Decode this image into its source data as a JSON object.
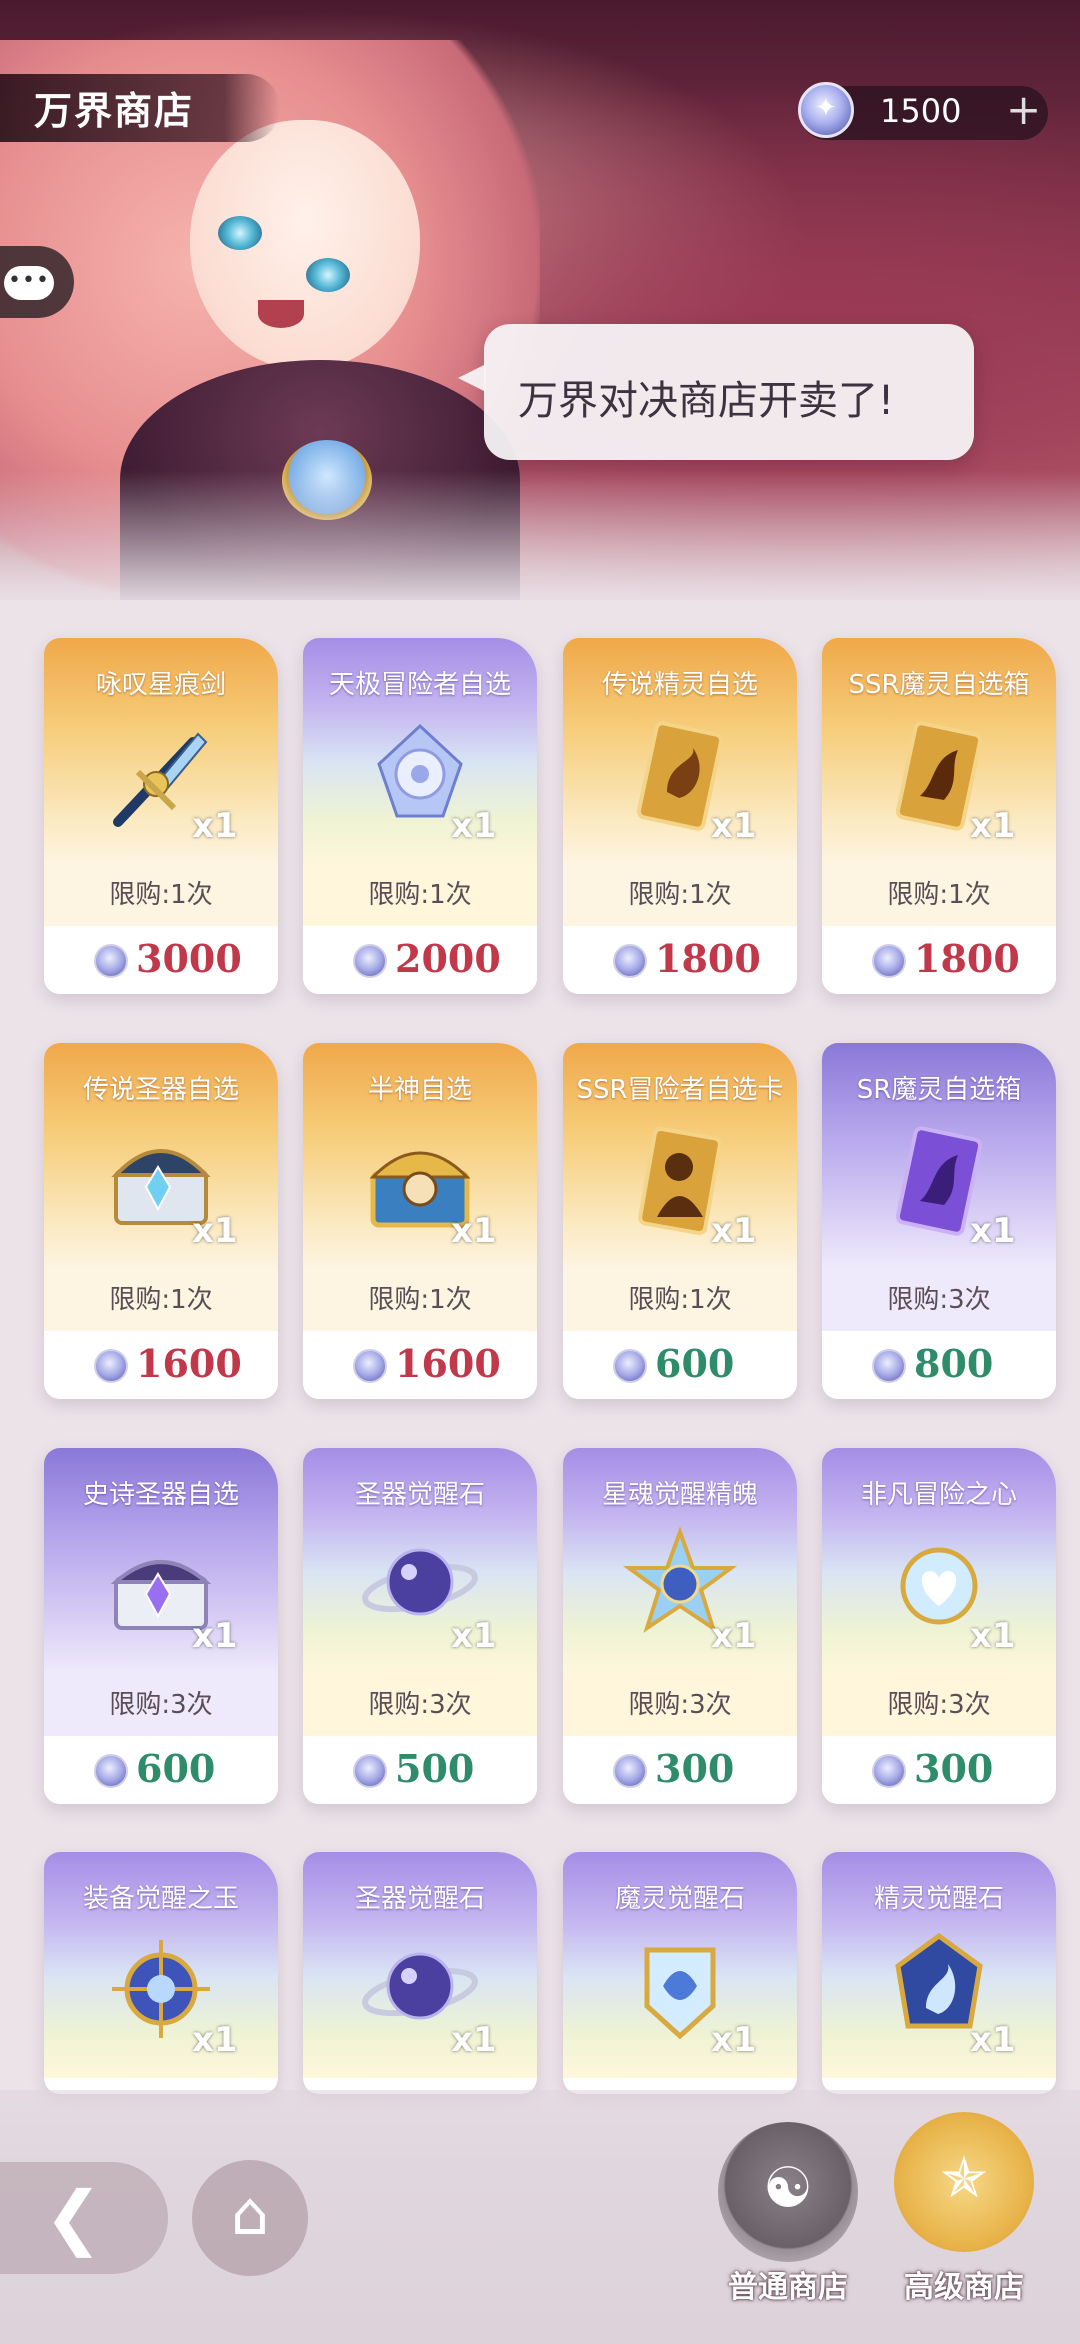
{
  "header": {
    "title": "万界商店",
    "currency_value": "1500",
    "currency_plus": "+"
  },
  "speech": {
    "text": "万界对决商店开卖了!"
  },
  "chat_button": {
    "label": "•••"
  },
  "items": [
    {
      "name": "咏叹星痕剑",
      "qty": "x1",
      "limit": "限购:1次",
      "price": "3000",
      "style": "gold",
      "price_color": "red",
      "icon": "sword-icon"
    },
    {
      "name": "天极冒险者自选",
      "qty": "x1",
      "limit": "限购:1次",
      "price": "2000",
      "style": "rainbow",
      "price_color": "red",
      "icon": "crystal-orb-icon"
    },
    {
      "name": "传说精灵自选",
      "qty": "x1",
      "limit": "限购:1次",
      "price": "1800",
      "style": "gold",
      "price_color": "red",
      "icon": "gold-spirit-card-icon"
    },
    {
      "name": "SSR魔灵自选箱",
      "qty": "x1",
      "limit": "限购:1次",
      "price": "1800",
      "style": "gold",
      "price_color": "red",
      "icon": "gold-dragon-card-icon"
    },
    {
      "name": "传说圣器自选",
      "qty": "x1",
      "limit": "限购:1次",
      "price": "1600",
      "style": "gold",
      "price_color": "red",
      "icon": "treasure-chest-icon"
    },
    {
      "name": "半神自选",
      "qty": "x1",
      "limit": "限购:1次",
      "price": "1600",
      "style": "gold",
      "price_color": "red",
      "icon": "ornate-chest-icon"
    },
    {
      "name": "SSR冒险者自选卡",
      "qty": "x1",
      "limit": "限购:1次",
      "price": "600",
      "style": "gold",
      "price_color": "green",
      "icon": "gold-hero-card-icon"
    },
    {
      "name": "SR魔灵自选箱",
      "qty": "x1",
      "limit": "限购:3次",
      "price": "800",
      "style": "purple",
      "price_color": "green",
      "icon": "purple-card-icon"
    },
    {
      "name": "史诗圣器自选",
      "qty": "x1",
      "limit": "限购:3次",
      "price": "600",
      "style": "purple",
      "price_color": "green",
      "icon": "silver-chest-icon"
    },
    {
      "name": "圣器觉醒石",
      "qty": "x1",
      "limit": "限购:3次",
      "price": "500",
      "style": "rainbow",
      "price_color": "green",
      "icon": "galaxy-orb-icon"
    },
    {
      "name": "星魂觉醒精魄",
      "qty": "x1",
      "limit": "限购:3次",
      "price": "300",
      "style": "rainbow",
      "price_color": "green",
      "icon": "star-emblem-icon"
    },
    {
      "name": "非凡冒险之心",
      "qty": "x1",
      "limit": "限购:3次",
      "price": "300",
      "style": "rainbow",
      "price_color": "green",
      "icon": "heart-gem-icon"
    },
    {
      "name": "装备觉醒之玉",
      "qty": "x1",
      "limit": "",
      "price": "",
      "style": "rainbow",
      "price_color": "green",
      "icon": "jade-orb-icon"
    },
    {
      "name": "圣器觉醒石",
      "qty": "x1",
      "limit": "",
      "price": "",
      "style": "rainbow",
      "price_color": "green",
      "icon": "galaxy-orb-icon"
    },
    {
      "name": "魔灵觉醒石",
      "qty": "x1",
      "limit": "",
      "price": "",
      "style": "rainbow",
      "price_color": "green",
      "icon": "blue-crest-icon"
    },
    {
      "name": "精灵觉醒石",
      "qty": "x1",
      "limit": "",
      "price": "",
      "style": "rainbow",
      "price_color": "green",
      "icon": "spirit-crest-icon"
    }
  ],
  "bottom_nav": {
    "normal_shop": "普通商店",
    "premium_shop": "高级商店"
  }
}
